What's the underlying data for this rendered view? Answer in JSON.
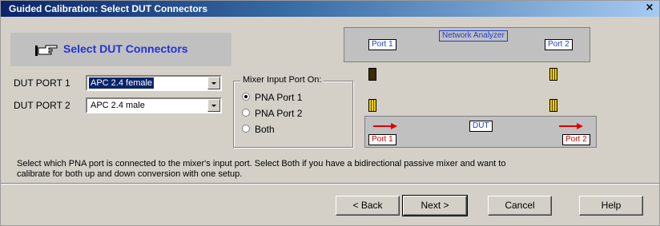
{
  "window": {
    "title": "Guided Calibration: Select DUT Connectors",
    "close_label": "×"
  },
  "header": {
    "icon": "pointing-hand-icon",
    "title": "Select DUT Connectors"
  },
  "dut_port_1": {
    "label": "DUT PORT 1",
    "value": "APC 2.4 female"
  },
  "dut_port_2": {
    "label": "DUT PORT 2",
    "value": "APC 2.4 male"
  },
  "mixer_group": {
    "legend": "Mixer Input Port On:",
    "options": [
      {
        "label": "PNA Port 1",
        "selected": true
      },
      {
        "label": "PNA Port 2",
        "selected": false
      },
      {
        "label": "Both",
        "selected": false
      }
    ]
  },
  "diagram": {
    "analyzer_port_1": "Port 1",
    "analyzer_label": "Network Analyzer",
    "analyzer_port_2": "Port 2",
    "dut_label": "DUT",
    "dut_port_1": "Port 1",
    "dut_port_2": "Port 2",
    "colors": {
      "tag_blue": "#1f3ccf",
      "tag_red": "#d40000",
      "arrow": "#e00000"
    }
  },
  "help_text": "Select which PNA port is connected to the mixer's input port.  Select Both if you have a bidirectional passive mixer and want to calibrate for both up and down conversion with one setup.",
  "buttons": {
    "back": "< Back",
    "next": "Next >",
    "cancel": "Cancel",
    "help": "Help"
  }
}
